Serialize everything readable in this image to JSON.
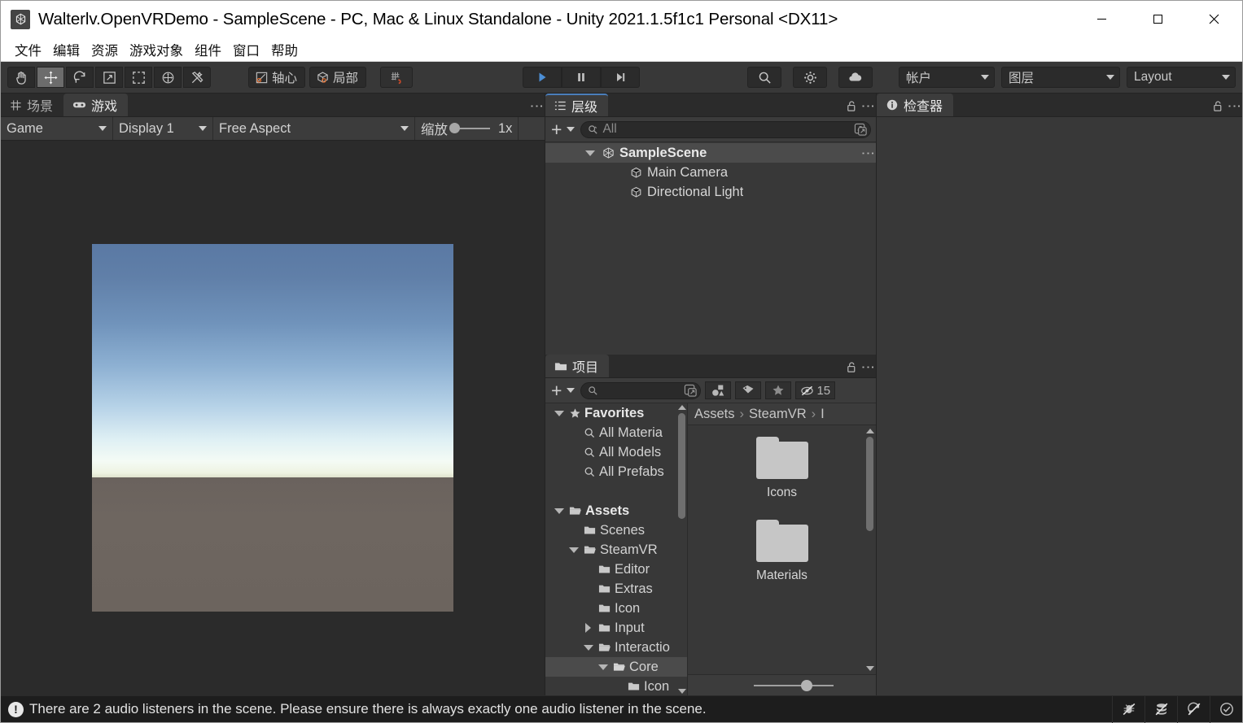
{
  "window": {
    "title": "Walterlv.OpenVRDemo - SampleScene - PC, Mac & Linux Standalone - Unity 2021.1.5f1c1 Personal <DX11>",
    "app_icon": "unity-logo-icon",
    "minimize_label": "—",
    "maximize_label": "☐",
    "close_label": "✕"
  },
  "menubar": {
    "items": [
      {
        "label": "文件",
        "name": "menu-file"
      },
      {
        "label": "编辑",
        "name": "menu-edit"
      },
      {
        "label": "资源",
        "name": "menu-assets"
      },
      {
        "label": "游戏对象",
        "name": "menu-gameobject"
      },
      {
        "label": "组件",
        "name": "menu-component"
      },
      {
        "label": "窗口",
        "name": "menu-window"
      },
      {
        "label": "帮助",
        "name": "menu-help"
      }
    ]
  },
  "toolbar": {
    "tools": [
      {
        "name": "hand-tool-icon",
        "selected": false
      },
      {
        "name": "move-tool-icon",
        "selected": true
      },
      {
        "name": "rotate-tool-icon",
        "selected": false
      },
      {
        "name": "scale-tool-icon",
        "selected": false
      },
      {
        "name": "rect-transform-tool-icon",
        "selected": false
      },
      {
        "name": "transform-tool-icon",
        "selected": false
      },
      {
        "name": "custom-editor-tool-icon",
        "selected": false
      }
    ],
    "pivot_label": "轴心",
    "handle_label": "局部",
    "snap_label": "grid-snap-icon",
    "play_label": "play-button-icon",
    "pause_label": "pause-button-icon",
    "step_label": "step-button-icon",
    "search_label": "search-icon",
    "collab_label": "collab-icon",
    "cloud_label": "cloud-icon",
    "account_label": "帐户",
    "layers_label": "图层",
    "layout_label": "Layout"
  },
  "game_panel": {
    "tabs": [
      {
        "label": "场景",
        "icon": "scene-grid-icon",
        "active": false
      },
      {
        "label": "游戏",
        "icon": "gamepad-icon",
        "active": true
      }
    ],
    "controls": {
      "target": "Game",
      "display": "Display 1",
      "aspect": "Free Aspect",
      "zoom_label": "缩放",
      "zoom_value": "1x"
    },
    "render": {
      "sky_top_color": "#5a79a4",
      "sky_horizon_color": "#f4fbf5",
      "ground_color": "#6c645e"
    }
  },
  "hierarchy": {
    "tab_label": "层级",
    "tab_icon": "hierarchy-list-icon",
    "lock_icon": "lock-open-icon",
    "menu_icon": "kebab-menu-icon",
    "add_label": "+",
    "search_placeholder": "All",
    "items": [
      {
        "label": "SampleScene",
        "depth": 0,
        "bold": true,
        "expanded": true,
        "icon": "unity-scene-icon",
        "selected": true,
        "has_menu": true
      },
      {
        "label": "Main Camera",
        "depth": 1,
        "bold": false,
        "expanded": null,
        "icon": "gameobject-cube-icon",
        "selected": false,
        "has_menu": false
      },
      {
        "label": "Directional Light",
        "depth": 1,
        "bold": false,
        "expanded": null,
        "icon": "gameobject-cube-icon",
        "selected": false,
        "has_menu": false
      }
    ]
  },
  "project": {
    "tab_label": "项目",
    "tab_icon": "folder-icon",
    "lock_icon": "lock-open-icon",
    "menu_icon": "kebab-menu-icon",
    "add_label": "+",
    "search_placeholder": "",
    "filters": [
      {
        "name": "type-filter-icon",
        "label": ""
      },
      {
        "name": "label-filter-icon",
        "label": ""
      },
      {
        "name": "favorite-star-icon",
        "label": ""
      },
      {
        "name": "hidden-packages-icon",
        "label": "15"
      }
    ],
    "breadcrumb": [
      "Assets",
      "SteamVR",
      "I"
    ],
    "tree": [
      {
        "label": "Favorites",
        "depth": 0,
        "bold": true,
        "twist": "down",
        "icon": "star-icon"
      },
      {
        "label": "All Materia",
        "depth": 1,
        "bold": false,
        "twist": "none",
        "icon": "search-icon"
      },
      {
        "label": "All Models",
        "depth": 1,
        "bold": false,
        "twist": "none",
        "icon": "search-icon"
      },
      {
        "label": "All Prefabs",
        "depth": 1,
        "bold": false,
        "twist": "none",
        "icon": "search-icon"
      },
      {
        "label": "",
        "depth": 0,
        "bold": false,
        "twist": "none",
        "icon": "none"
      },
      {
        "label": "Assets",
        "depth": 0,
        "bold": true,
        "twist": "down",
        "icon": "folder-open-icon"
      },
      {
        "label": "Scenes",
        "depth": 1,
        "bold": false,
        "twist": "none",
        "icon": "folder-icon"
      },
      {
        "label": "SteamVR",
        "depth": 1,
        "bold": false,
        "twist": "down",
        "icon": "folder-open-icon"
      },
      {
        "label": "Editor",
        "depth": 2,
        "bold": false,
        "twist": "none",
        "icon": "folder-icon"
      },
      {
        "label": "Extras",
        "depth": 2,
        "bold": false,
        "twist": "none",
        "icon": "folder-icon"
      },
      {
        "label": "Icon",
        "depth": 2,
        "bold": false,
        "twist": "none",
        "icon": "folder-icon"
      },
      {
        "label": "Input",
        "depth": 2,
        "bold": false,
        "twist": "right",
        "icon": "folder-icon"
      },
      {
        "label": "Interactio",
        "depth": 2,
        "bold": false,
        "twist": "down",
        "icon": "folder-open-icon"
      },
      {
        "label": "Core",
        "depth": 3,
        "bold": false,
        "twist": "down",
        "icon": "folder-open-icon",
        "selected": true
      },
      {
        "label": "Icon",
        "depth": 4,
        "bold": false,
        "twist": "none",
        "icon": "folder-icon"
      }
    ],
    "assets": [
      {
        "label": "Icons",
        "icon": "folder-icon"
      },
      {
        "label": "Materials",
        "icon": "folder-icon"
      }
    ]
  },
  "inspector": {
    "tab_label": "检查器",
    "tab_icon": "info-circle-icon",
    "lock_icon": "lock-open-icon",
    "menu_icon": "kebab-menu-icon"
  },
  "statusbar": {
    "icon": "warning-icon",
    "message": "There are 2 audio listeners in the scene. Please ensure there is always exactly one audio listener in the scene.",
    "icons": [
      {
        "name": "debug-bug-off-icon"
      },
      {
        "name": "code-coverage-off-icon"
      },
      {
        "name": "auto-refresh-off-icon"
      },
      {
        "name": "check-circle-icon"
      }
    ]
  }
}
